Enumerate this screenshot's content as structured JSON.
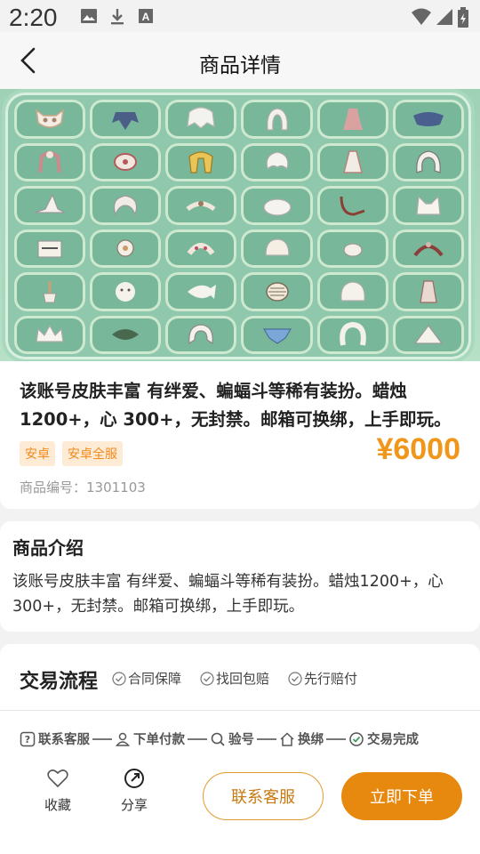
{
  "status_bar": {
    "time": "2:20"
  },
  "header": {
    "title": "商品详情"
  },
  "product": {
    "title": "该账号皮肤丰富 有绊爱、蝙蝠斗等稀有装扮。蜡烛1200+，心 300+，无封禁。邮箱可换绑，上手即玩。",
    "tags": [
      "安卓",
      "安卓全服"
    ],
    "price": "¥6000",
    "number": "商品编号：1301103"
  },
  "intro": {
    "title": "商品介绍",
    "text": "该账号皮肤丰富 有绊爱、蝙蝠斗等稀有装扮。蜡烛1200+，心 300+，无封禁。邮箱可换绑，上手即玩。"
  },
  "trade": {
    "title": "交易流程",
    "guarantees": [
      "合同保障",
      "找回包赔",
      "先行赔付"
    ],
    "steps": [
      "联系客服",
      "下单付款",
      "验号",
      "换绑",
      "交易完成"
    ]
  },
  "bottom_bar": {
    "favorite": "收藏",
    "share": "分享",
    "contact": "联系客服",
    "buy": "立即下单"
  },
  "colors": {
    "accent": "#e8890f",
    "price": "#f0971b",
    "tag_bg": "#fdebd6"
  }
}
